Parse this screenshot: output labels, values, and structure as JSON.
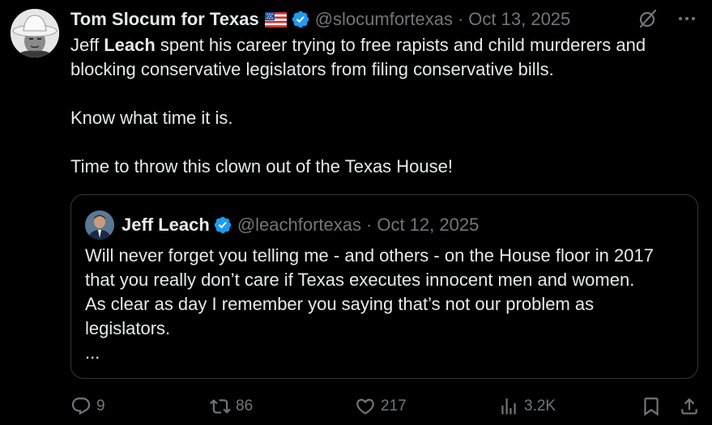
{
  "tweet": {
    "author": {
      "display_name": "Tom Slocum for Texas",
      "flag": "us-flag-icon",
      "verified": true,
      "handle": "@slocumfortexas",
      "separator": "·",
      "date": "Oct 13, 2025"
    },
    "body": {
      "line1_pre": "Jeff ",
      "line1_bold": "Leach",
      "line1_post": " spent his career trying to free rapists and child murderers and",
      "line2": "blocking conservative legislators from filing conservative bills.",
      "line3": "Know what time it is.",
      "line4": "Time to throw this clown out of the Texas House!"
    },
    "top_icons": [
      "grok-icon",
      "more-icon"
    ]
  },
  "quote": {
    "author": {
      "display_name": "Jeff Leach",
      "verified": true,
      "handle": "@leachfortexas",
      "separator": "·",
      "date": "Oct 12, 2025"
    },
    "lines": [
      "Will never forget you telling me - and others - on the House floor in 2017",
      "that you really don’t care if Texas executes innocent men and women.",
      "As clear as day I remember you saying that’s not our problem as",
      "legislators.",
      "..."
    ]
  },
  "actions": {
    "replies": "9",
    "reposts": "86",
    "likes": "217",
    "views": "3.2K"
  },
  "colors": {
    "background": "#000000",
    "text": "#e7e9ea",
    "muted": "#71767b",
    "border": "#333639",
    "verified": "#1d9bf0"
  }
}
